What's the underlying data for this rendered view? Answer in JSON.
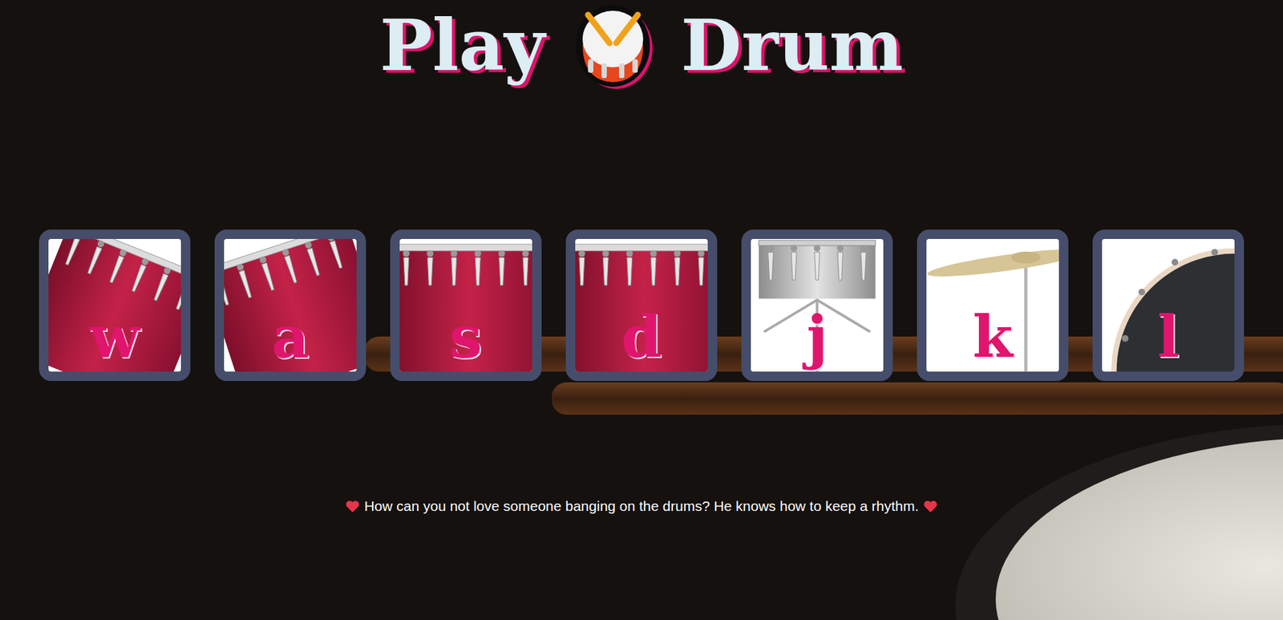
{
  "title": {
    "before": "Play",
    "after": "Drum"
  },
  "drums": [
    {
      "key": "w",
      "kind": "tomleft"
    },
    {
      "key": "a",
      "kind": "tomright"
    },
    {
      "key": "s",
      "kind": "floor"
    },
    {
      "key": "d",
      "kind": "floor"
    },
    {
      "key": "j",
      "kind": "snare"
    },
    {
      "key": "k",
      "kind": "cymbal"
    },
    {
      "key": "l",
      "kind": "kick"
    }
  ],
  "footer": "How can you not love someone banging on the drums? He knows how to keep a rhythm."
}
